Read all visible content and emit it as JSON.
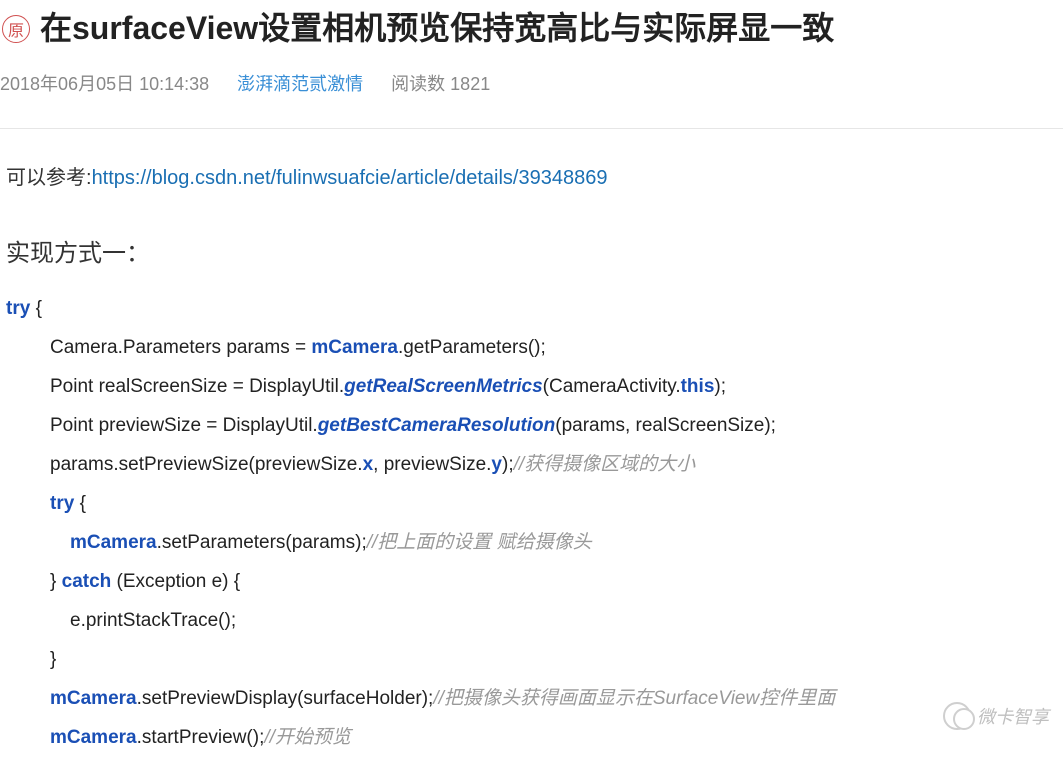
{
  "header": {
    "badge": "原",
    "title": "在surfaceView设置相机预览保持宽高比与实际屏显一致",
    "date": "2018年06月05日 10:14:38",
    "author": "澎湃滴范贰激情",
    "reads_label": "阅读数",
    "reads_count": "1821"
  },
  "content": {
    "reference_prefix": "可以参考:",
    "reference_url": "https://blog.csdn.net/fulinwsuafcie/article/details/39348869",
    "section_heading": "实现方式一："
  },
  "code": {
    "l1_try": "try",
    "l1_brace": " {",
    "l2_a": "Camera.Parameters params = ",
    "l2_b": "mCamera",
    "l2_c": ".getParameters();",
    "l3_a": "Point realScreenSize = DisplayUtil.",
    "l3_b": "getRealScreenMetrics",
    "l3_c": "(CameraActivity.",
    "l3_d": "this",
    "l3_e": ");",
    "l4_a": "Point previewSize = DisplayUtil.",
    "l4_b": "getBestCameraResolution",
    "l4_c": "(params, realScreenSize);",
    "l5_a": "params.setPreviewSize(previewSize.",
    "l5_b": "x",
    "l5_c": ", previewSize.",
    "l5_d": "y",
    "l5_e": ");",
    "l5_cmt": "//获得摄像区域的大小",
    "l6_try": "try",
    "l6_brace": " {",
    "l7_a": "mCamera",
    "l7_b": ".setParameters(params);",
    "l7_cmt": "//把上面的设置  赋给摄像头",
    "l8_a": "} ",
    "l8_b": "catch",
    "l8_c": " (Exception e) {",
    "l9": "e.printStackTrace();",
    "l10": "}",
    "l11_a": "mCamera",
    "l11_b": ".setPreviewDisplay(surfaceHolder);",
    "l11_cmt": "//把摄像头获得画面显示在SurfaceView控件里面",
    "l12_a": "mCamera",
    "l12_b": ".startPreview();",
    "l12_cmt": "//开始预览"
  },
  "watermark": "微卡智享"
}
